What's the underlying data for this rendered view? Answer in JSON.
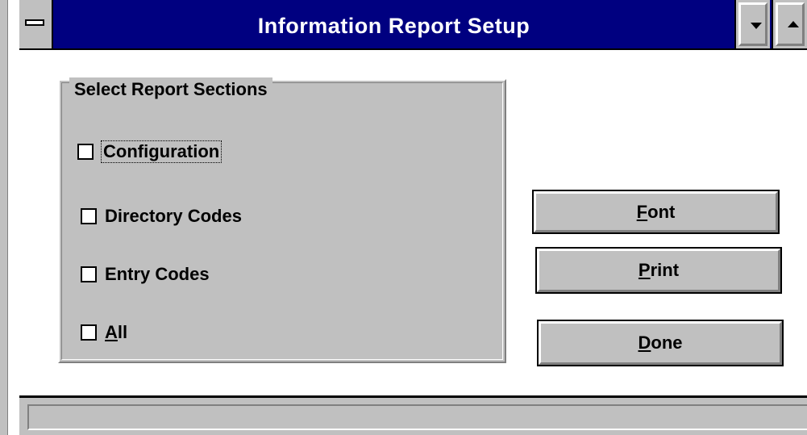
{
  "window": {
    "title": "Information Report Setup"
  },
  "group": {
    "label": "Select Report Sections",
    "options": [
      {
        "label": "Configuration",
        "checked": false,
        "focused": true
      },
      {
        "label": "Directory Codes",
        "checked": false
      },
      {
        "label": "Entry Codes",
        "checked": false
      },
      {
        "label_mnemonic": "A",
        "label_rest": "ll",
        "checked": false
      }
    ]
  },
  "buttons": {
    "font": {
      "mnemonic": "F",
      "rest": "ont"
    },
    "print": {
      "mnemonic": "P",
      "rest": "rint"
    },
    "done": {
      "mnemonic": "D",
      "rest": "one"
    }
  },
  "status": {
    "text": ""
  },
  "icons": {
    "system_menu": "system-menu-icon",
    "minimize": "minimize-arrow-icon",
    "maximize": "maximize-arrow-icon"
  },
  "colors": {
    "titlebar": "#000080",
    "face": "#c0c0c0",
    "title_text": "#ffffff"
  }
}
